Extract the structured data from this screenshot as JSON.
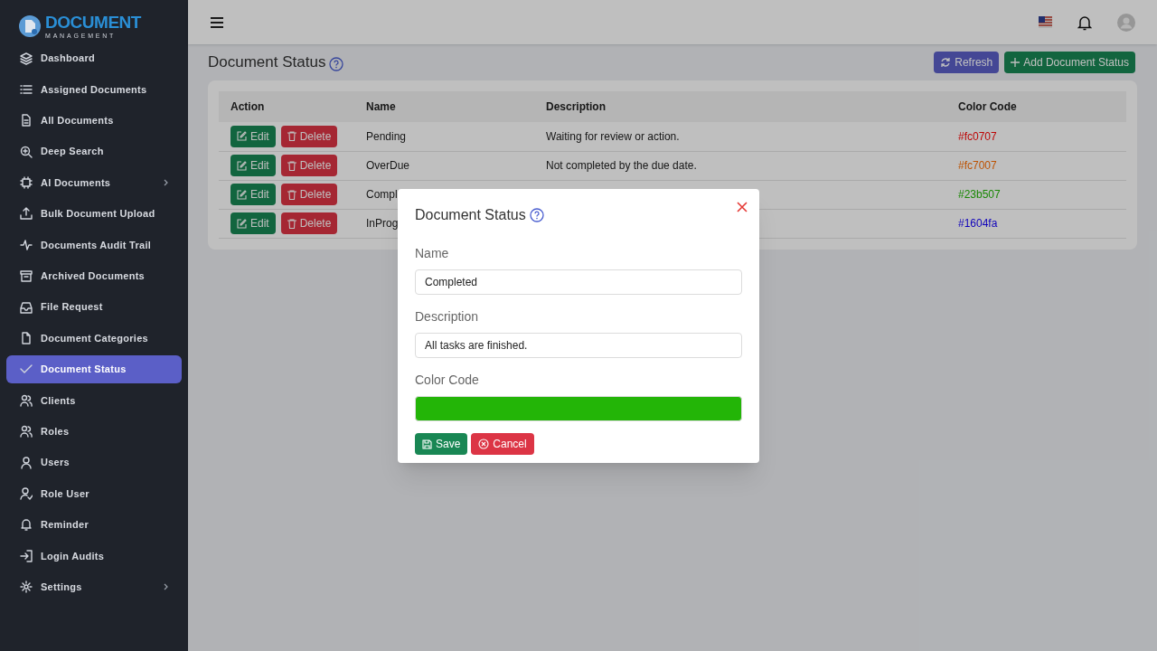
{
  "logo": {
    "title": "DOCUMENT",
    "subtitle": "MANAGEMENT"
  },
  "sidebar": {
    "items": [
      {
        "label": "Dashboard",
        "selected": false
      },
      {
        "label": "Assigned Documents",
        "selected": false
      },
      {
        "label": "All Documents",
        "selected": false
      },
      {
        "label": "Deep Search",
        "selected": false
      },
      {
        "label": "AI Documents",
        "selected": false,
        "has_submenu": true
      },
      {
        "label": "Bulk Document Upload",
        "selected": false
      },
      {
        "label": "Documents Audit Trail",
        "selected": false
      },
      {
        "label": "Archived Documents",
        "selected": false
      },
      {
        "label": "File Request",
        "selected": false
      },
      {
        "label": "Document Categories",
        "selected": false
      },
      {
        "label": "Document Status",
        "selected": true
      },
      {
        "label": "Clients",
        "selected": false
      },
      {
        "label": "Roles",
        "selected": false
      },
      {
        "label": "Users",
        "selected": false
      },
      {
        "label": "Role User",
        "selected": false
      },
      {
        "label": "Reminder",
        "selected": false
      },
      {
        "label": "Login Audits",
        "selected": false
      },
      {
        "label": "Settings",
        "selected": false,
        "has_submenu": true
      }
    ]
  },
  "page": {
    "title": "Document Status",
    "buttons": [
      {
        "kind": "refresh",
        "label": "Refresh"
      },
      {
        "kind": "add",
        "label": "Add Document Status"
      }
    ]
  },
  "table": {
    "columns": [
      "Action",
      "Name",
      "Description",
      "Color Code"
    ],
    "rows": [
      {
        "edit_label": "Edit",
        "delete_label": "Delete",
        "name": "Pending",
        "description": "Waiting for review or action.",
        "color_code": "#fc0707"
      },
      {
        "edit_label": "Edit",
        "delete_label": "Delete",
        "name": "OverDue",
        "description": "Not completed by the due date.",
        "color_code": "#fc7007"
      },
      {
        "edit_label": "Edit",
        "delete_label": "Delete",
        "name": "Compl",
        "color_code": "#23b507"
      },
      {
        "edit_label": "Edit",
        "delete_label": "Delete",
        "name": "InProg",
        "color_code": "#1604fa"
      }
    ]
  },
  "modal": {
    "title": "Document Status",
    "fields": [
      {
        "kind": "text",
        "label": "Name",
        "value": "Completed"
      },
      {
        "kind": "text",
        "label": "Description",
        "value": "All tasks are finished."
      },
      {
        "kind": "color",
        "label": "Color Code",
        "color": "#23b507"
      }
    ],
    "save": "Save",
    "cancel": "Cancel"
  }
}
